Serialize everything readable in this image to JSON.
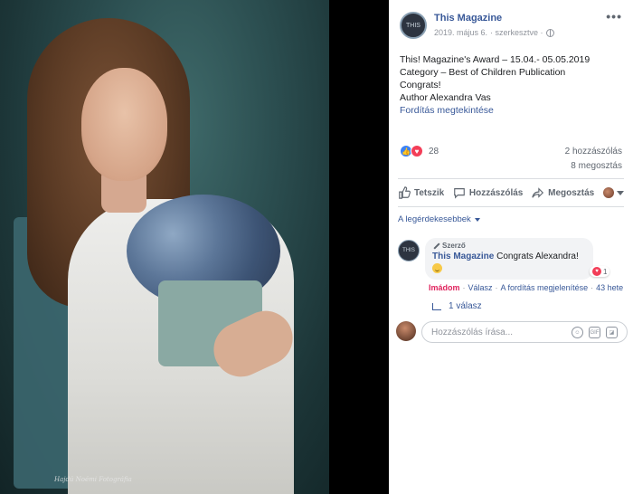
{
  "photo": {
    "signature": "Hajdú Noémi Fotográfia"
  },
  "post": {
    "page_name": "This Magazine",
    "avatar_text": "THIS",
    "date": "2019. május 6.",
    "edited_label": "· szerkesztve ·",
    "more_label": "•••",
    "text_lines": [
      "This! Magazine's Award – 15.04.- 05.05.2019",
      "Category – Best of Children Publication",
      "Congrats!",
      "Author Alexandra Vas"
    ],
    "see_translation": "Fordítás megtekintése",
    "reaction_count": "28",
    "comment_count": "2 hozzászólás",
    "share_count": "8 megosztás"
  },
  "actions": {
    "like": "Tetszik",
    "comment": "Hozzászólás",
    "share": "Megosztás"
  },
  "comments": {
    "sort_label": "A legérdekesebbek",
    "items": [
      {
        "badge": "Szerző",
        "author": "This Magazine",
        "text": "Congrats Alexandra!",
        "reaction_count": "1",
        "loved_label": "Imádom",
        "reply_label": "Válasz",
        "translate_label": "A fordítás megjelenítése",
        "time": "43 hete"
      }
    ],
    "replies_label": "1 válasz"
  },
  "composer": {
    "placeholder": "Hozzászólás írása...",
    "icons": [
      "emoji-icon",
      "gif-icon",
      "sticker-icon"
    ]
  },
  "colors": {
    "link": "#385898",
    "like": "#3b82f6",
    "love": "#f33e58",
    "muted": "#606770"
  }
}
